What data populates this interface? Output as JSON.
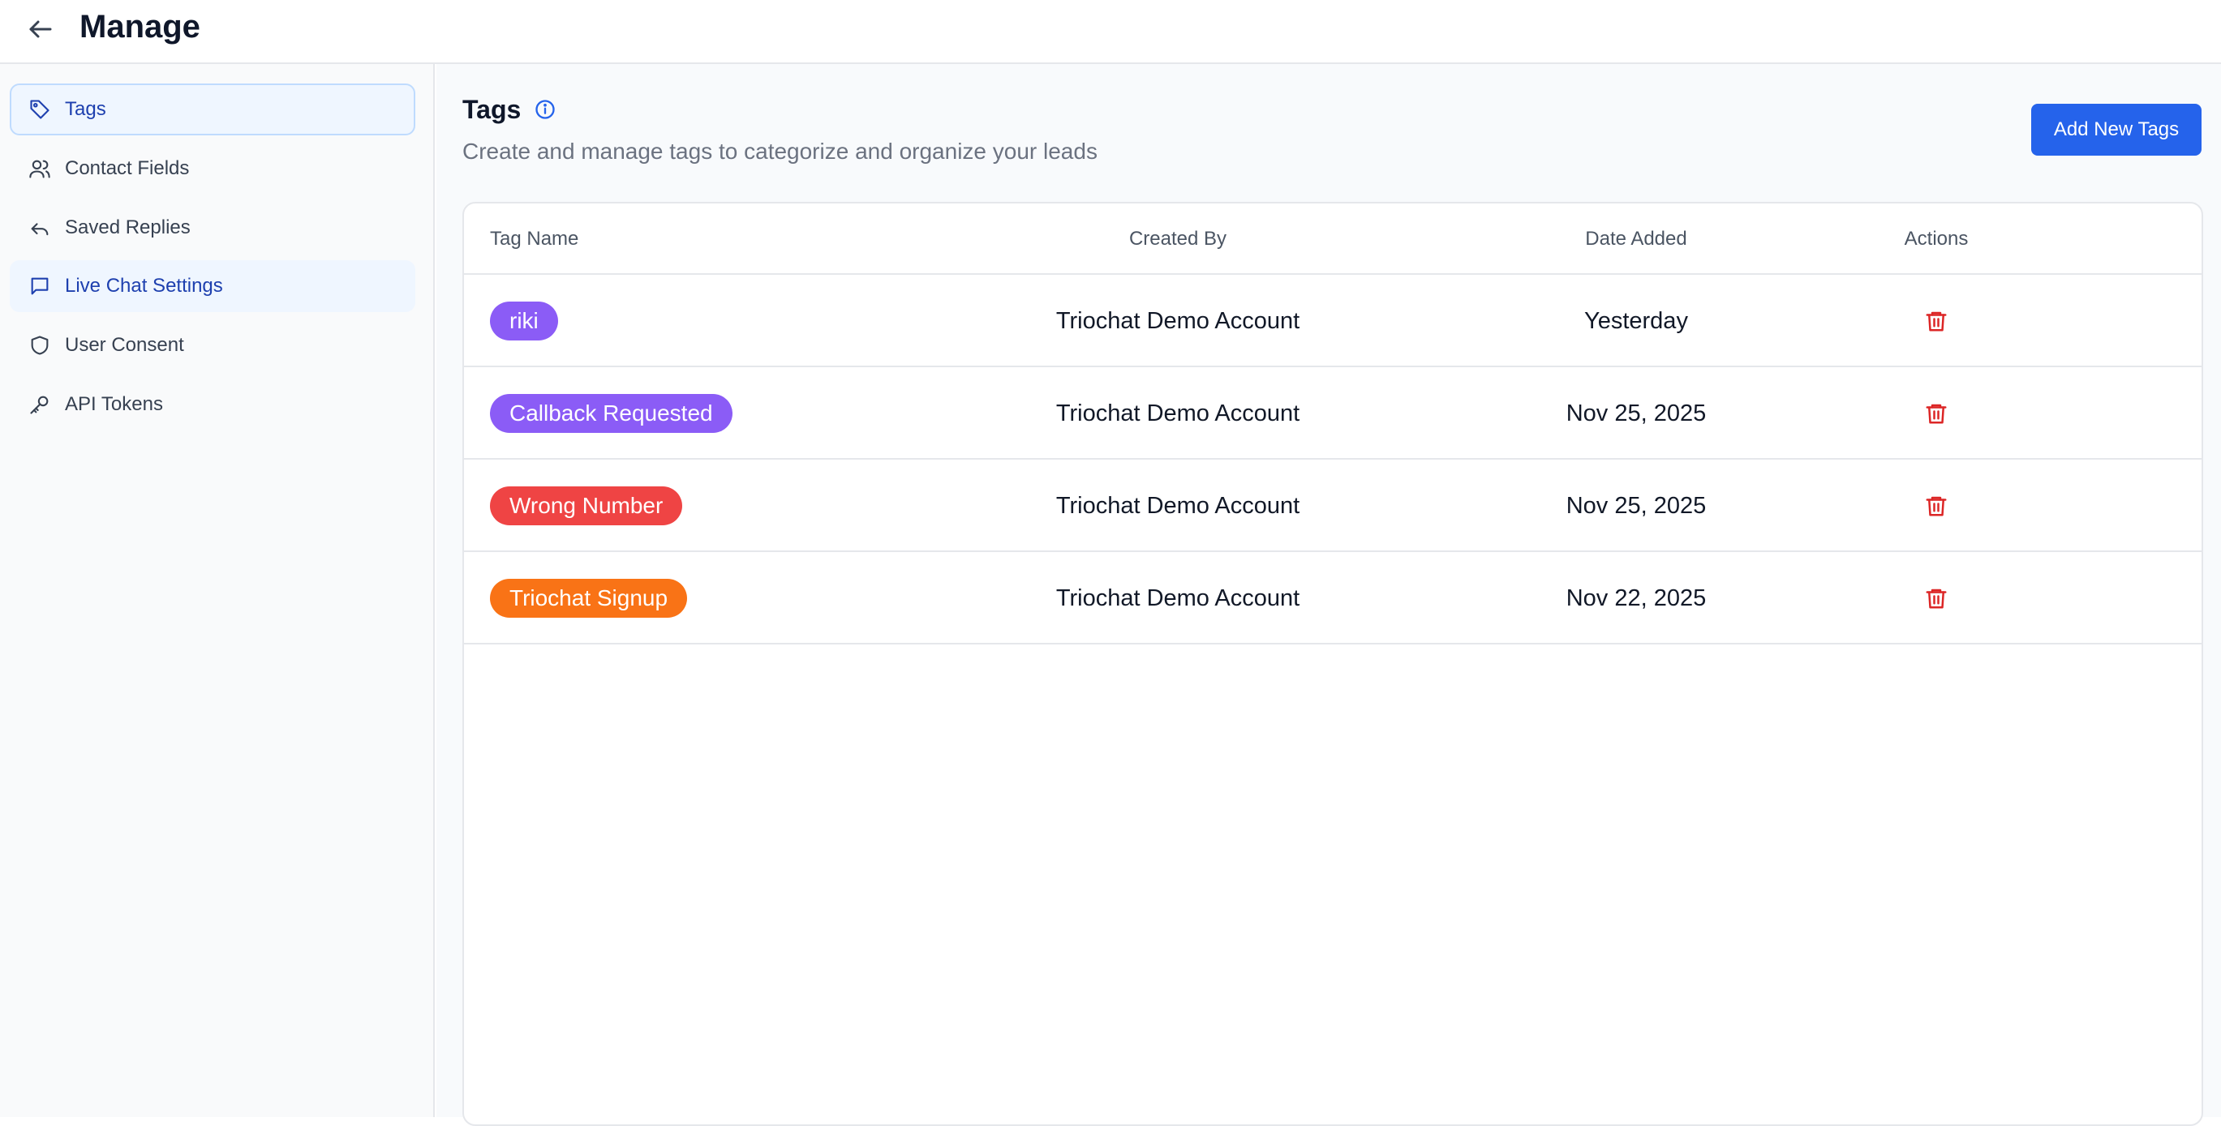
{
  "header": {
    "title": "Manage"
  },
  "sidebar": {
    "items": [
      {
        "label": "Tags",
        "icon": "tag-icon",
        "state": "active"
      },
      {
        "label": "Contact Fields",
        "icon": "users-icon",
        "state": ""
      },
      {
        "label": "Saved Replies",
        "icon": "reply-icon",
        "state": ""
      },
      {
        "label": "Live Chat Settings",
        "icon": "chat-icon",
        "state": "highlight"
      },
      {
        "label": "User Consent",
        "icon": "shield-icon",
        "state": ""
      },
      {
        "label": "API Tokens",
        "icon": "key-icon",
        "state": ""
      }
    ]
  },
  "main": {
    "title": "Tags",
    "subtitle": "Create and manage tags to categorize and organize your leads",
    "add_button_label": "Add New Tags",
    "table": {
      "columns": [
        "Tag Name",
        "Created By",
        "Date Added",
        "Actions"
      ],
      "rows": [
        {
          "tag": "riki",
          "tag_color": "#8b5cf6",
          "created_by": "Triochat Demo Account",
          "date_added": "Yesterday"
        },
        {
          "tag": "Callback Requested",
          "tag_color": "#8b5cf6",
          "created_by": "Triochat Demo Account",
          "date_added": "Nov 25, 2025"
        },
        {
          "tag": "Wrong Number",
          "tag_color": "#ef4444",
          "created_by": "Triochat Demo Account",
          "date_added": "Nov 25, 2025"
        },
        {
          "tag": "Triochat Signup",
          "tag_color": "#f97316",
          "created_by": "Triochat Demo Account",
          "date_added": "Nov 22, 2025"
        }
      ]
    }
  },
  "colors": {
    "accent": "#2563eb",
    "delete": "#dc2626"
  }
}
